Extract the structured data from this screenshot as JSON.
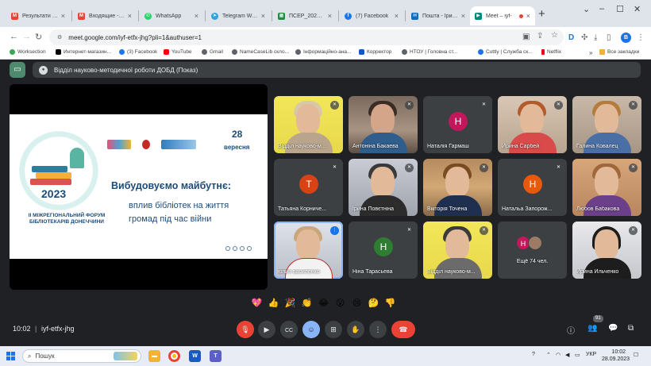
{
  "tabs": [
    {
      "label": "Результати пош",
      "icon": "gmail-icon",
      "color": "#ea4335",
      "glyph": "M"
    },
    {
      "label": "Входящие - 18",
      "icon": "gmail-icon",
      "color": "#ea4335",
      "glyph": "M"
    },
    {
      "label": "WhatsApp",
      "icon": "whatsapp-icon",
      "color": "#25d366",
      "glyph": "✆"
    },
    {
      "label": "Telegram Web",
      "icon": "telegram-icon",
      "color": "#2aa3df",
      "glyph": "➤"
    },
    {
      "label": "ПСЕР_2024 - Go",
      "icon": "sheets-icon",
      "color": "#1e8e3e",
      "glyph": "▦"
    },
    {
      "label": "(7) Facebook",
      "icon": "facebook-icon",
      "color": "#1877f2",
      "glyph": "f"
    },
    {
      "label": "Пошта - Ірина",
      "icon": "outlook-icon",
      "color": "#0f6cbd",
      "glyph": "✉"
    },
    {
      "label": "Meet – iyf-",
      "icon": "meet-icon",
      "color": "#00897b",
      "glyph": "▶"
    }
  ],
  "browser": {
    "url": "meet.google.com/iyf-etfx-jhg?pli=1&authuser=1",
    "profile_initial": "B"
  },
  "bookmarks": [
    {
      "label": "Worksection",
      "color": "#3aa757"
    },
    {
      "label": "Интернет-магазин...",
      "color": "#000000"
    },
    {
      "label": "(3) Facebook",
      "color": "#1877f2"
    },
    {
      "label": "YouTube",
      "color": "#ff0000"
    },
    {
      "label": "Gmail",
      "color": "#5f6368"
    },
    {
      "label": "NameCaseLib скло...",
      "color": "#5f6368"
    },
    {
      "label": "Інформаційно-ана...",
      "color": "#5f6368"
    },
    {
      "label": "Корректор",
      "color": "#0b57d0"
    },
    {
      "label": "НТОУ | Головна ст...",
      "color": "#5f6368"
    },
    {
      "label": "Cuttly | Служба ск...",
      "color": "#1a73e8"
    },
    {
      "label": "Netflix",
      "color": "#e50914"
    },
    {
      "label": "Все закладки",
      "color": "#f2b233"
    }
  ],
  "meet": {
    "presentation_title": "Відділ науково-методичної роботи ДОБД (Показ)",
    "clock": "10:02",
    "separator": "|",
    "meeting_code": "iyf-etfx-jhg",
    "participants_count": "91"
  },
  "slide": {
    "year": "2023",
    "forum": "II МІЖРЕГІОНАЛЬНИЙ ФОРУМ БІБЛІОТЕКАРІВ ДОНЕЧЧИНИ",
    "date_day": "28",
    "date_month": "вересня",
    "headline": "Вибудовуємо майбутнє:",
    "sub1": "вплив бібліотек на життя",
    "sub2": "громад під час війни"
  },
  "participants": [
    {
      "name": "Відділ науково-м...",
      "type": "yellow",
      "mic": "muted"
    },
    {
      "name": "Антоніна Бакаева",
      "type": "video",
      "mic": "muted"
    },
    {
      "name": "Наталія Гармаш",
      "type": "avatar",
      "initial": "Н",
      "color": "#c2185b",
      "mic": "muted"
    },
    {
      "name": "Ирина Сарбей",
      "type": "video",
      "mic": "muted"
    },
    {
      "name": "Галина Ковалец",
      "type": "video",
      "mic": "muted"
    },
    {
      "name": "Татьяна Корниче...",
      "type": "avatar",
      "initial": "Т",
      "color": "#d84315",
      "mic": "muted"
    },
    {
      "name": "Ірина Повєтніна",
      "type": "light",
      "mic": "muted"
    },
    {
      "name": "Вікторія Точена",
      "type": "indoor",
      "mic": "muted"
    },
    {
      "name": "Натальа Запорож...",
      "type": "avatar",
      "initial": "Н",
      "color": "#e8590c",
      "mic": "muted"
    },
    {
      "name": "Любов Бабакова",
      "type": "indoor",
      "mic": "muted"
    },
    {
      "name": "юлия василенко",
      "type": "light",
      "mic": "talking",
      "speaking": true
    },
    {
      "name": "Ніна Тарасьева",
      "type": "avatar",
      "initial": "Н",
      "color": "#2e7d32",
      "mic": "muted"
    },
    {
      "name": "Відділ науково-м...",
      "type": "yellow",
      "mic": "muted"
    },
    {
      "name": "Ещё 74 чел.",
      "type": "more",
      "initial": "Н",
      "color": "#c2185b"
    },
    {
      "name": "Ирина Ильченко",
      "type": "video",
      "mic": "muted"
    }
  ],
  "reactions": [
    "💖",
    "👍",
    "🎉",
    "👏",
    "😂",
    "😮",
    "😢",
    "🤔",
    "👎"
  ],
  "taskbar": {
    "search_label": "Пошук",
    "language": "УКР",
    "time": "10:02",
    "date": "28.09.2023"
  }
}
